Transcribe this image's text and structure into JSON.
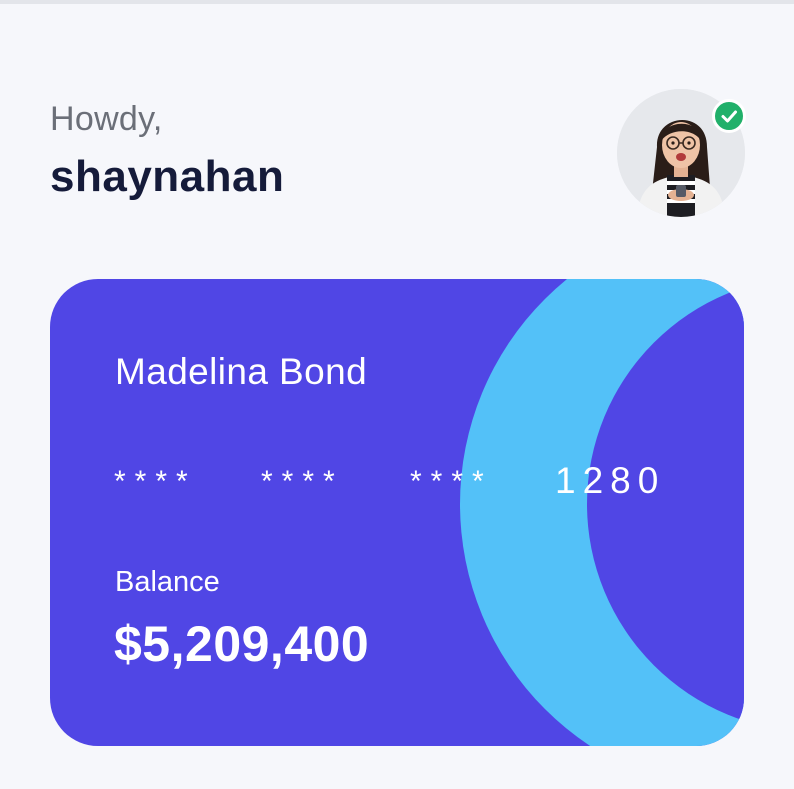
{
  "greeting": "Howdy,",
  "user": {
    "username": "shaynahan",
    "verified": true
  },
  "card": {
    "holder_name": "Madelina Bond",
    "number_masked_groups": [
      "****",
      "****",
      "****"
    ],
    "number_last4": "1280",
    "balance_label": "Balance",
    "balance_amount": "$5,209,400"
  },
  "colors": {
    "background": "#f6f7fb",
    "card": "#5046e5",
    "card_accent": "#53c1f8",
    "heading": "#151b3a",
    "muted_text": "#6b6f78",
    "verified": "#21b06a"
  },
  "icons": {
    "avatar": "user-avatar-icon",
    "verified": "check-badge-icon"
  }
}
